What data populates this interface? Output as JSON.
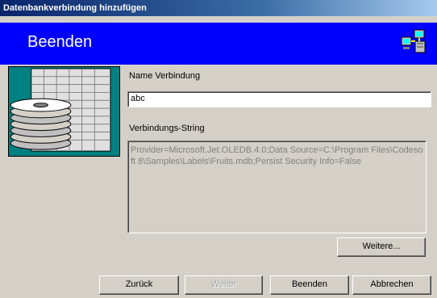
{
  "window": {
    "title": "Datenbankverbindung hinzufügen"
  },
  "header": {
    "title": "Beenden",
    "icon": "network-computers-icon",
    "background": "#0000ff"
  },
  "art": {
    "icon": "database-disks-icon",
    "background": "#008080"
  },
  "form": {
    "name_label": "Name Verbindung",
    "name_value": "abc",
    "string_label": "Verbindungs-String",
    "string_value": "Provider=Microsoft.Jet.OLEDB.4.0;Data Source=C:\\Program Files\\Codesoft 8\\Samples\\Labels\\Fruits.mdb;Persist Security Info=False"
  },
  "buttons": {
    "more": "Weitere...",
    "back": "Zurück",
    "next": "Weiter",
    "finish": "Beenden",
    "cancel": "Abbrechen"
  }
}
